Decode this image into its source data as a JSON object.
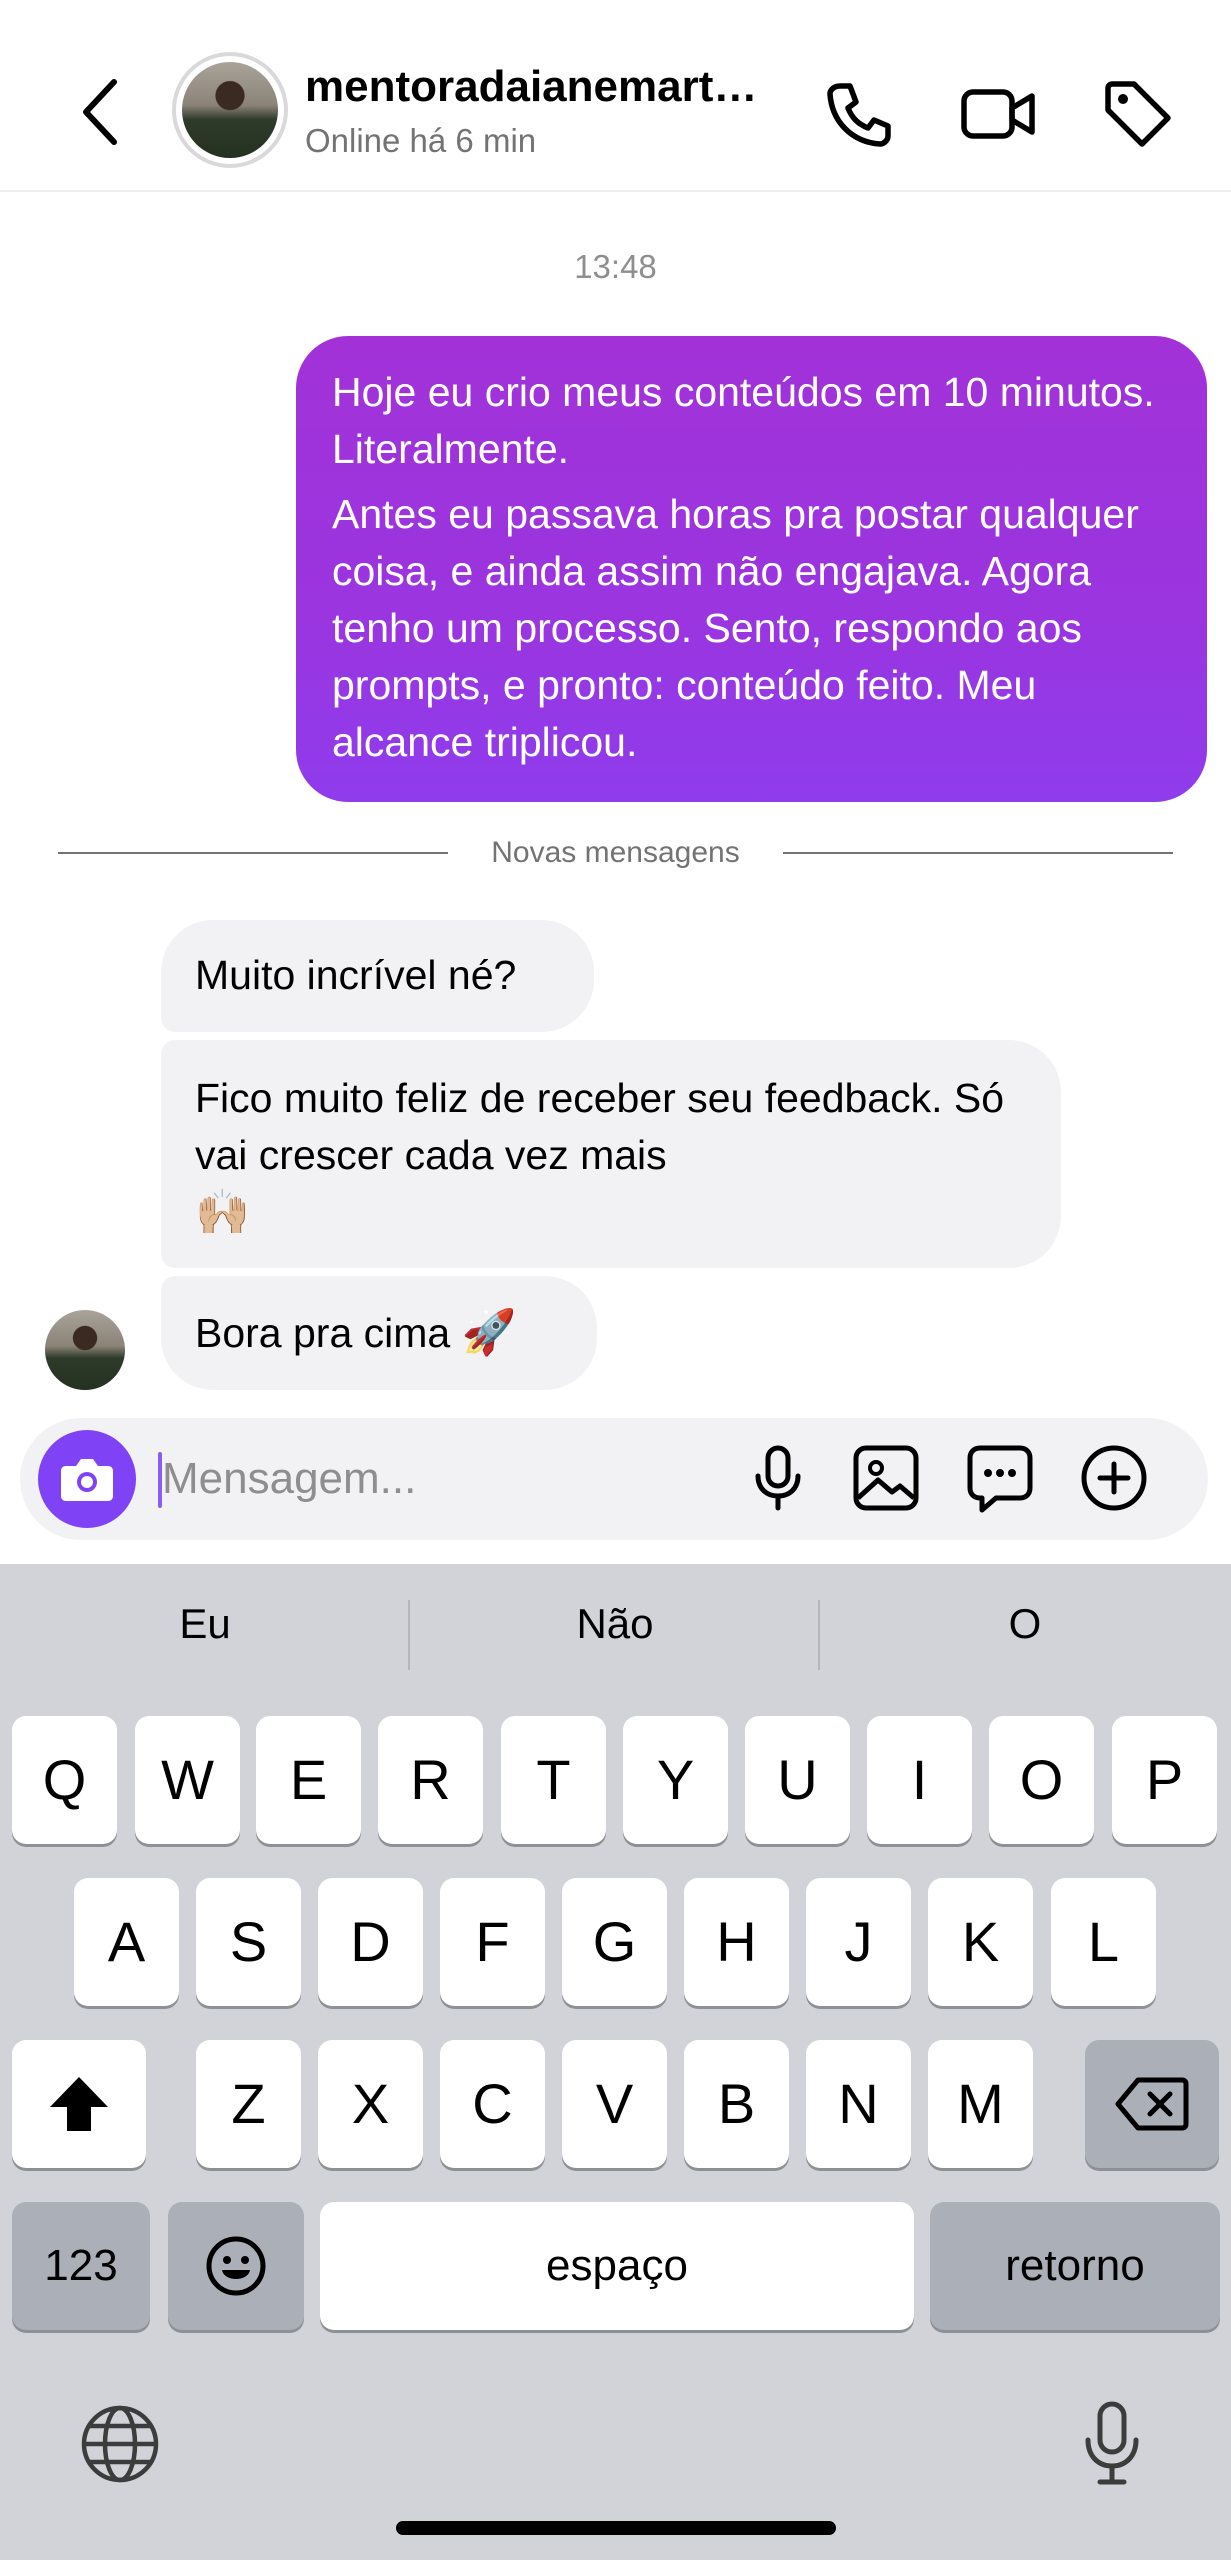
{
  "header": {
    "contact_name": "mentoradaianemart…",
    "status": "Online há 6 min"
  },
  "chat": {
    "timestamp": "13:48",
    "outgoing": {
      "line1": "Hoje eu crio meus conteúdos em 10 minutos. Literalmente.",
      "line2": "Antes eu passava horas pra postar qualquer coisa, e ainda assim não engajava. Agora tenho um processo. Sento, respondo aos prompts, e pronto: conteúdo feito. Meu alcance triplicou."
    },
    "divider_label": "Novas mensagens",
    "incoming": [
      {
        "text": "Muito incrível né?"
      },
      {
        "text": "Fico muito feliz de receber seu feedback. Só vai crescer cada vez mais",
        "emoji": "🙌🏼"
      },
      {
        "text": "Bora pra cima",
        "emoji": "🚀"
      }
    ]
  },
  "composer": {
    "placeholder": "Mensagem...",
    "value": ""
  },
  "keyboard": {
    "suggestions": [
      "Eu",
      "Não",
      "O"
    ],
    "row1": [
      "Q",
      "W",
      "E",
      "R",
      "T",
      "Y",
      "U",
      "I",
      "O",
      "P"
    ],
    "row2": [
      "A",
      "S",
      "D",
      "F",
      "G",
      "H",
      "J",
      "K",
      "L"
    ],
    "row3": [
      "Z",
      "X",
      "C",
      "V",
      "B",
      "N",
      "M"
    ],
    "numbers_label": "123",
    "space_label": "espaço",
    "return_label": "retorno"
  },
  "colors": {
    "accent": "#7f43f5",
    "bubble_out_top": "#a232d8",
    "bubble_out_bottom": "#8f3cec",
    "bubble_in": "#f2f2f4",
    "keyboard_bg": "#d1d3d9"
  },
  "icons": {
    "back": "chevron-left-icon",
    "call": "phone-icon",
    "video": "video-camera-icon",
    "tag": "tag-icon",
    "camera": "camera-icon",
    "mic": "microphone-icon",
    "gallery": "image-icon",
    "sticker": "message-dots-icon",
    "more": "plus-circle-icon",
    "shift": "shift-icon",
    "backspace": "backspace-icon",
    "emoji": "emoji-icon",
    "globe": "globe-icon",
    "dictation": "microphone-icon"
  }
}
